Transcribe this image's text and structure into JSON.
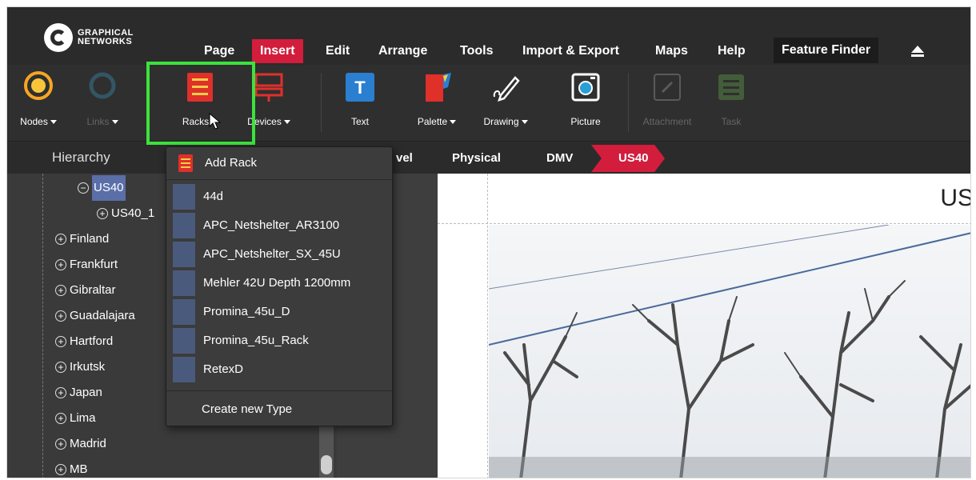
{
  "app": {
    "logo_line1": "GRAPHICAL",
    "logo_line2": "NETWORKS"
  },
  "menu": {
    "items": [
      {
        "label": "Page"
      },
      {
        "label": "Insert"
      },
      {
        "label": "Edit"
      },
      {
        "label": "Arrange"
      },
      {
        "label": "Tools"
      },
      {
        "label": "Import & Export"
      },
      {
        "label": "Maps"
      },
      {
        "label": "Help"
      }
    ],
    "feature_finder": "Feature Finder"
  },
  "toolbar": {
    "nodes": "Nodes",
    "links": "Links",
    "racks": "Racks",
    "devices": "Devices",
    "text": "Text",
    "palette": "Palette",
    "drawing": "Drawing",
    "picture": "Picture",
    "attachment": "Attachment",
    "task": "Task"
  },
  "subbar": {
    "hierarchy_title": "Hierarchy",
    "breadcrumbs": [
      "vel",
      "Physical",
      "DMV",
      "US40"
    ]
  },
  "hierarchy": {
    "items": [
      {
        "label": "US40"
      },
      {
        "label": "US40_1"
      },
      {
        "label": "Finland"
      },
      {
        "label": "Frankfurt"
      },
      {
        "label": "Gibraltar"
      },
      {
        "label": "Guadalajara"
      },
      {
        "label": "Hartford"
      },
      {
        "label": "Irkutsk"
      },
      {
        "label": "Japan"
      },
      {
        "label": "Lima"
      },
      {
        "label": "Madrid"
      },
      {
        "label": "MB"
      }
    ]
  },
  "dropdown": {
    "add_rack": "Add Rack",
    "rack_types": [
      {
        "label": "44d"
      },
      {
        "label": "APC_Netshelter_AR3100"
      },
      {
        "label": "APC_Netshelter_SX_45U"
      },
      {
        "label": "Mehler 42U Depth 1200mm"
      },
      {
        "label": "Promina_45u_D"
      },
      {
        "label": "Promina_45u_Rack"
      },
      {
        "label": "RetexD"
      }
    ],
    "create_new_type": "Create new Type"
  },
  "canvas": {
    "title": "US"
  },
  "colors": {
    "accent_red": "#d21d3c",
    "highlight_green": "#3ce23c",
    "selection_blue": "#5a6ea8"
  }
}
